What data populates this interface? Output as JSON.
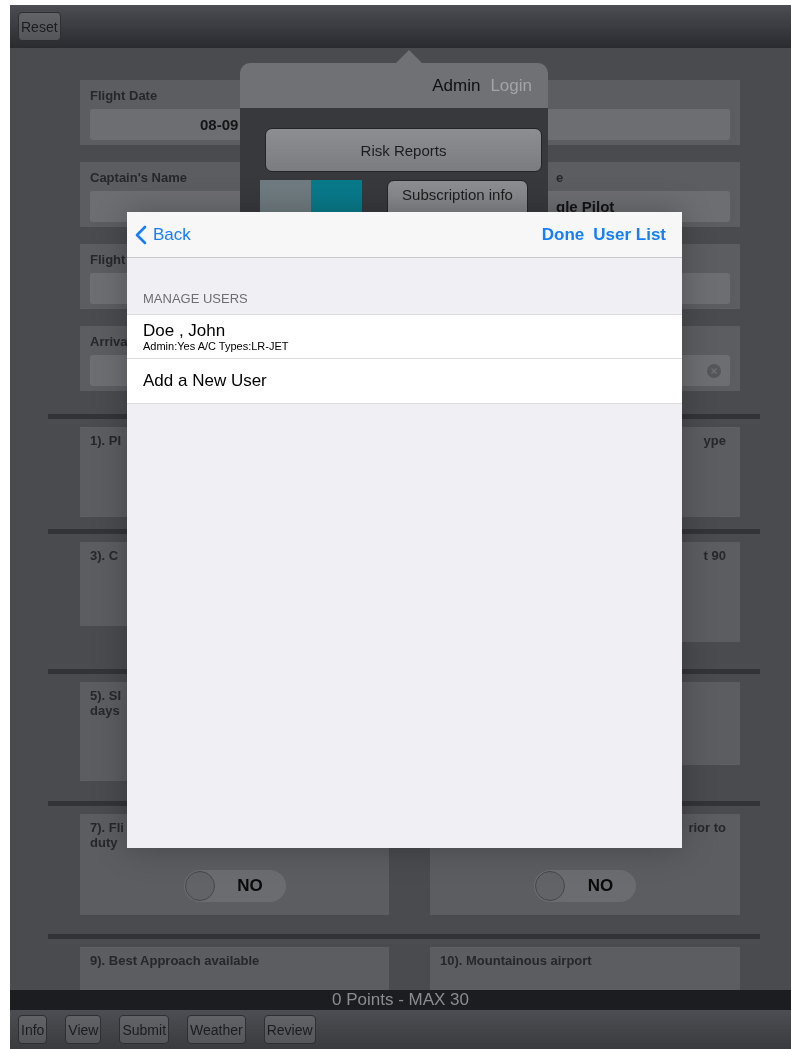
{
  "top_bar": {
    "reset": "Reset"
  },
  "form_fields": [
    {
      "kind": "wide",
      "label": "Flight Date",
      "value": "08-09"
    },
    {
      "kind": "split",
      "label": "Captain's Name",
      "right_label": "e",
      "right_value": "gle Pilot"
    },
    {
      "kind": "wide",
      "label": "Flight"
    },
    {
      "kind": "wide",
      "label": "Arriva",
      "clear_button": true
    }
  ],
  "questions": [
    {
      "left": {
        "lines": [
          "1). PI"
        ]
      },
      "right": {
        "kind": "tail",
        "lines": [
          "ype"
        ]
      }
    },
    {
      "left": {
        "lines": [
          "3). C"
        ]
      },
      "right": {
        "kind": "tail",
        "lines": [
          "t 90"
        ]
      }
    },
    {
      "left": {
        "lines": [
          "5). SI",
          "days"
        ]
      }
    },
    {
      "left": {
        "lines": [
          "7). Fli",
          "duty"
        ],
        "toggle": {
          "label": "NO",
          "on": false
        }
      },
      "right": {
        "kind": "tail",
        "lines": [
          "rior to"
        ],
        "toggle": {
          "label": "NO",
          "on": false
        }
      }
    },
    {
      "left": {
        "lines": [
          "9). Best Approach available"
        ]
      },
      "right": {
        "lines": [
          "10). Mountainous airport"
        ]
      }
    }
  ],
  "popover": {
    "tabs": [
      {
        "label": "Admin",
        "selected": true
      },
      {
        "label": "Login",
        "selected": false
      }
    ],
    "buttons": [
      "Risk Reports",
      "Subscription info"
    ],
    "swatches": [
      {
        "color": "#6f7b80"
      },
      {
        "color": "#087a8a"
      }
    ]
  },
  "modal": {
    "back": "Back",
    "actions": [
      "Done",
      "User List"
    ],
    "section": "MANAGE USERS",
    "rows": [
      {
        "title": "Doe , John",
        "subtitle": "Admin:Yes A/C Types:LR-JET"
      },
      {
        "title": "Add a New User"
      }
    ]
  },
  "status_bar": "0 Points - MAX 30",
  "toolbar": [
    "Info",
    "View",
    "Submit",
    "Weather",
    "Review"
  ]
}
